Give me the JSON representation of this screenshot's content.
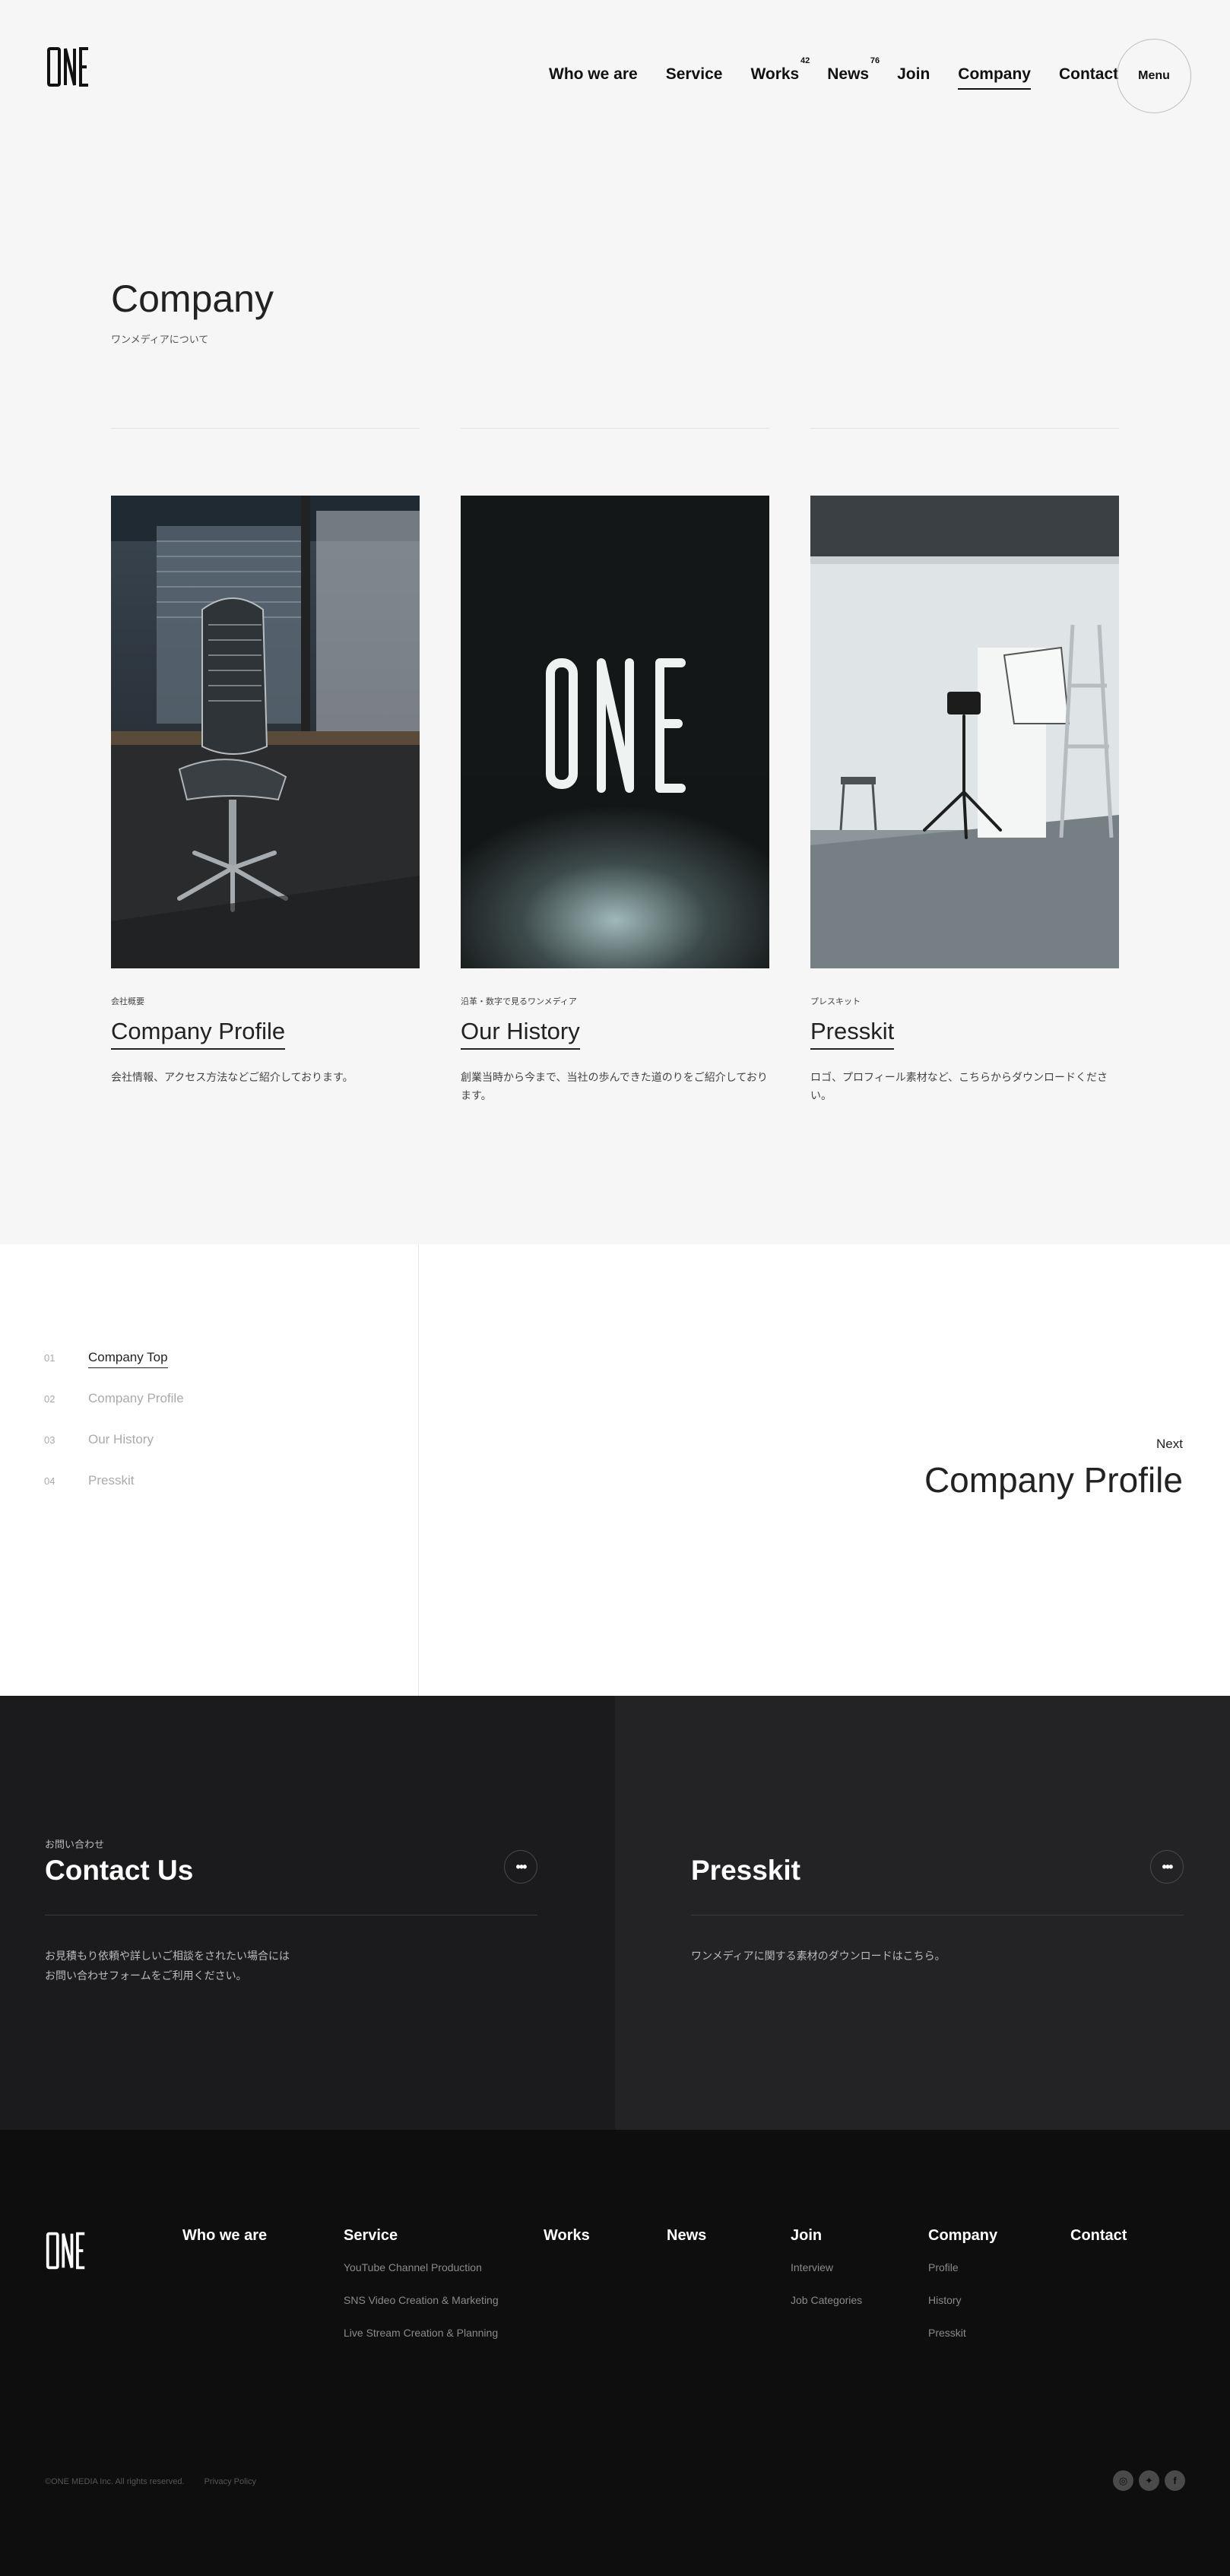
{
  "header": {
    "logo_text": "ONE",
    "nav": [
      {
        "label": "Who we are",
        "badge": ""
      },
      {
        "label": "Service",
        "badge": ""
      },
      {
        "label": "Works",
        "badge": "42"
      },
      {
        "label": "News",
        "badge": "76"
      },
      {
        "label": "Join",
        "badge": ""
      },
      {
        "label": "Company",
        "badge": "",
        "active": true
      },
      {
        "label": "Contact",
        "badge": ""
      }
    ],
    "menu_label": "Menu"
  },
  "page": {
    "title": "Company",
    "subtitle": "ワンメディアについて"
  },
  "cards": [
    {
      "kicker": "会社概要",
      "title": "Company Profile",
      "desc": "会社情報、アクセス方法などご紹介しております。",
      "image": "office-chair-photo"
    },
    {
      "kicker": "沿革・数字で見るワンメディア",
      "title": "Our History",
      "desc": "創業当時から今まで、当社の歩んできた道のりをご紹介しております。",
      "image": "one-sign-photo"
    },
    {
      "kicker": "プレスキット",
      "title": "Presskit",
      "desc": "ロゴ、プロフィール素材など、こちらからダウンロードください。",
      "image": "studio-tripod-photo"
    }
  ],
  "subnav": {
    "items": [
      {
        "num": "01",
        "label": "Company Top",
        "current": true
      },
      {
        "num": "02",
        "label": "Company Profile"
      },
      {
        "num": "03",
        "label": "Our History"
      },
      {
        "num": "04",
        "label": "Presskit"
      }
    ],
    "next_label": "Next",
    "next_title": "Company Profile"
  },
  "cta": {
    "contact": {
      "kicker": "お問い合わせ",
      "title": "Contact Us",
      "body_line1": "お見積もり依頼や詳しいご相談をされたい場合には",
      "body_line2": "お問い合わせフォームをご利用ください。",
      "icon": "more-dots-icon",
      "icon_glyph": "•••"
    },
    "presskit": {
      "title": "Presskit",
      "body": "ワンメディアに関する素材のダウンロードはこちら。",
      "icon": "more-dots-icon",
      "icon_glyph": "•••"
    }
  },
  "footer": {
    "logo_text": "ONE",
    "columns": [
      {
        "heading": "Who we are",
        "links": []
      },
      {
        "heading": "Service",
        "links": [
          "YouTube Channel Production",
          "SNS Video Creation & Marketing",
          "Live Stream Creation & Planning"
        ]
      },
      {
        "heading": "Works",
        "links": []
      },
      {
        "heading": "News",
        "links": []
      },
      {
        "heading": "Join",
        "links": [
          "Interview",
          "Job Categories"
        ]
      },
      {
        "heading": "Company",
        "links": [
          "Profile",
          "History",
          "Presskit"
        ]
      },
      {
        "heading": "Contact",
        "links": []
      }
    ],
    "copyright": "©ONE MEDIA Inc. All rights reserved.",
    "privacy": "Privacy Policy",
    "social": [
      {
        "name": "instagram-icon",
        "glyph": "◎"
      },
      {
        "name": "twitter-icon",
        "glyph": "✦"
      },
      {
        "name": "facebook-icon",
        "glyph": "f"
      }
    ]
  },
  "colors": {
    "background": "#f6f6f6",
    "cta_left": "#1b1b1d",
    "cta_right": "#232325",
    "footer": "#0e0e0e"
  }
}
